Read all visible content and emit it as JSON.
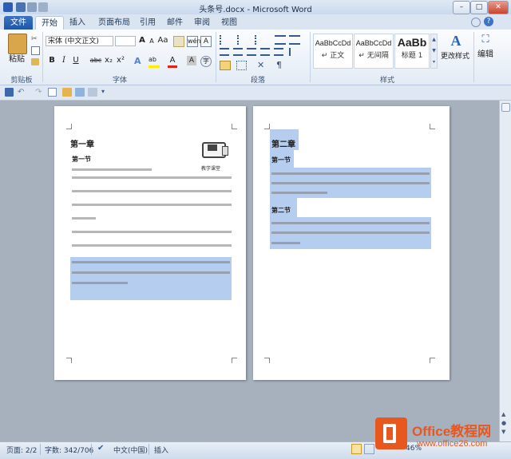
{
  "window": {
    "title": "头条号.docx - Microsoft Word",
    "minimize": "–",
    "maximize": "□",
    "close": "✕"
  },
  "tabs": [
    "文件",
    "开始",
    "插入",
    "页面布局",
    "引用",
    "邮件",
    "审阅",
    "视图"
  ],
  "ribbon": {
    "clipboard": {
      "paste_label": "粘贴",
      "group_label": "剪贴板"
    },
    "font": {
      "font_name": "宋体 (中文正文)",
      "font_size": "",
      "group_label": "字体",
      "bold": "B",
      "italic": "I",
      "underline": "U",
      "strike": "abc",
      "subscript": "x₂",
      "superscript": "x²",
      "change_case": "Aa",
      "grow": "A",
      "shrink": "A"
    },
    "paragraph": {
      "group_label": "段落"
    },
    "styles": {
      "group_label": "样式",
      "items": [
        {
          "sample": "AaBbCcDd",
          "label": "↵ 正文"
        },
        {
          "sample": "AaBbCcDd",
          "label": "↵ 无间隔"
        },
        {
          "sample": "AaBb",
          "label": "标题 1"
        }
      ],
      "change_styles": "更改样式"
    },
    "editing": {
      "label": "编辑"
    }
  },
  "document": {
    "page1": {
      "chapter": "第一章",
      "section": "第一节",
      "logo_text": "教学课堂"
    },
    "page2": {
      "chapter": "第二章",
      "section1": "第一节",
      "section2": "第二节"
    }
  },
  "status": {
    "page": "页面: 2/2",
    "words": "字数: 342/706",
    "language": "中文(中国)",
    "mode": "插入",
    "zoom": "46%"
  },
  "watermark": {
    "brand": "Office教程网",
    "url": "www.office26.com"
  },
  "colors": {
    "file_tab": "#2a62b6",
    "highlight": "#b5cdef",
    "watermark_orange": "#e8571e"
  }
}
